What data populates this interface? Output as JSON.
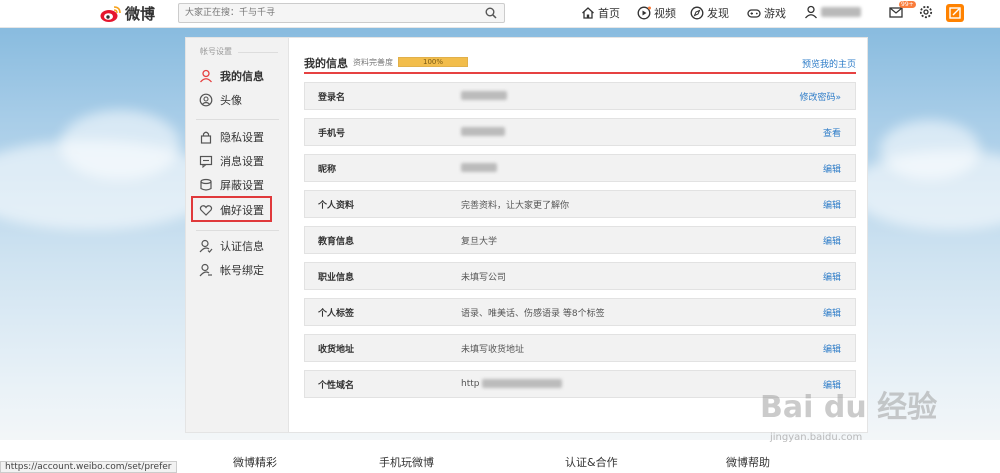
{
  "topbar": {
    "logo_text": "微博",
    "search_placeholder": "大家正在搜：千与千寻",
    "nav": {
      "home": "首页",
      "video": "视频",
      "discover": "发现",
      "games": "游戏"
    },
    "message_badge": "99+"
  },
  "sidebar": {
    "title": "帐号设置",
    "items": [
      {
        "label": "我的信息",
        "icon": "user-icon"
      },
      {
        "label": "头像",
        "icon": "avatar-icon"
      },
      {
        "label": "隐私设置",
        "icon": "lock-icon"
      },
      {
        "label": "消息设置",
        "icon": "message-icon"
      },
      {
        "label": "屏蔽设置",
        "icon": "block-icon"
      },
      {
        "label": "偏好设置",
        "icon": "heart-icon"
      },
      {
        "label": "认证信息",
        "icon": "verify-icon"
      },
      {
        "label": "帐号绑定",
        "icon": "bind-icon"
      }
    ]
  },
  "content": {
    "title": "我的信息",
    "completeness_label": "资料完善度",
    "completeness_percent": 100,
    "completeness_text": "100%",
    "preview_link": "预览我的主页",
    "rows": [
      {
        "label": "登录名",
        "value": "",
        "action": "修改密码»"
      },
      {
        "label": "手机号",
        "value": "",
        "action": "查看"
      },
      {
        "label": "昵称",
        "value": "",
        "action": "编辑"
      },
      {
        "label": "个人资料",
        "value": "完善资料，让大家更了解你",
        "action": "编辑"
      },
      {
        "label": "教育信息",
        "value": "复旦大学",
        "action": "编辑"
      },
      {
        "label": "职业信息",
        "value": "未填写公司",
        "action": "编辑"
      },
      {
        "label": "个人标签",
        "value": "语录、唯美话、伤感语录 等8个标签",
        "action": "编辑"
      },
      {
        "label": "收货地址",
        "value": "未填写收货地址",
        "action": "编辑"
      },
      {
        "label": "个性域名",
        "value": "http",
        "action": "编辑"
      }
    ]
  },
  "footer": {
    "items": [
      "微博精彩",
      "手机玩微博",
      "认证&合作",
      "微博帮助"
    ]
  },
  "status_url": "https://account.weibo.com/set/prefer",
  "watermark": {
    "main": "Bai du 经验",
    "sub": "jingyan.baidu.com"
  },
  "colors": {
    "accent_red": "#e64141",
    "link_blue": "#2d7cc8",
    "brand_orange": "#ff8200"
  }
}
